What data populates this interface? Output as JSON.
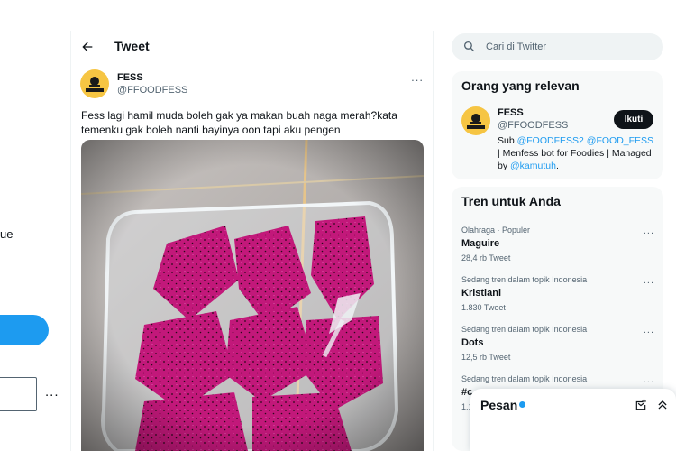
{
  "left_nav": {
    "fragment_text": "ue",
    "more_label": "..."
  },
  "header": {
    "title": "Tweet"
  },
  "tweet": {
    "author_name": "FESS",
    "author_handle": "@FFOODFESS",
    "more_label": "...",
    "text": "Fess lagi hamil muda boleh gak ya makan buah naga merah?kata temenku gak boleh nanti bayinya oon tapi aku pengen",
    "avatar_logo_text": "FOODFESS"
  },
  "search": {
    "placeholder": "Cari di Twitter"
  },
  "relevant": {
    "title": "Orang yang relevan",
    "name": "FESS",
    "handle": "@FFOODFESS",
    "follow_label": "Ikuti",
    "bio": {
      "prefix": "Sub ",
      "link1": "@FOODFESS2",
      "space": " ",
      "link2": "@FOOD_FESS",
      "middle": " | Menfess bot for Foodies | Managed by ",
      "link3": "@kamutuh",
      "suffix": "."
    }
  },
  "trends": {
    "title": "Tren untuk Anda",
    "items": [
      {
        "meta": "Olahraga · Populer",
        "name": "Maguire",
        "count": "28,4 rb Tweet"
      },
      {
        "meta": "Sedang tren dalam topik Indonesia",
        "name": "Kristiani",
        "count": "1.830 Tweet"
      },
      {
        "meta": "Sedang tren dalam topik Indonesia",
        "name": "Dots",
        "count": "12,5 rb Tweet"
      },
      {
        "meta": "Sedang tren dalam topik Indonesia",
        "name": "#c",
        "count": "1.1"
      }
    ],
    "more_label": "..."
  },
  "messages": {
    "title": "Pesan"
  },
  "colors": {
    "accent": "#1d9bf0",
    "text": "#0f1419",
    "secondary": "#536471",
    "card_bg": "#f7f9f9",
    "avatar_yellow": "#f6c543",
    "dragonfruit": "#c2187a"
  }
}
